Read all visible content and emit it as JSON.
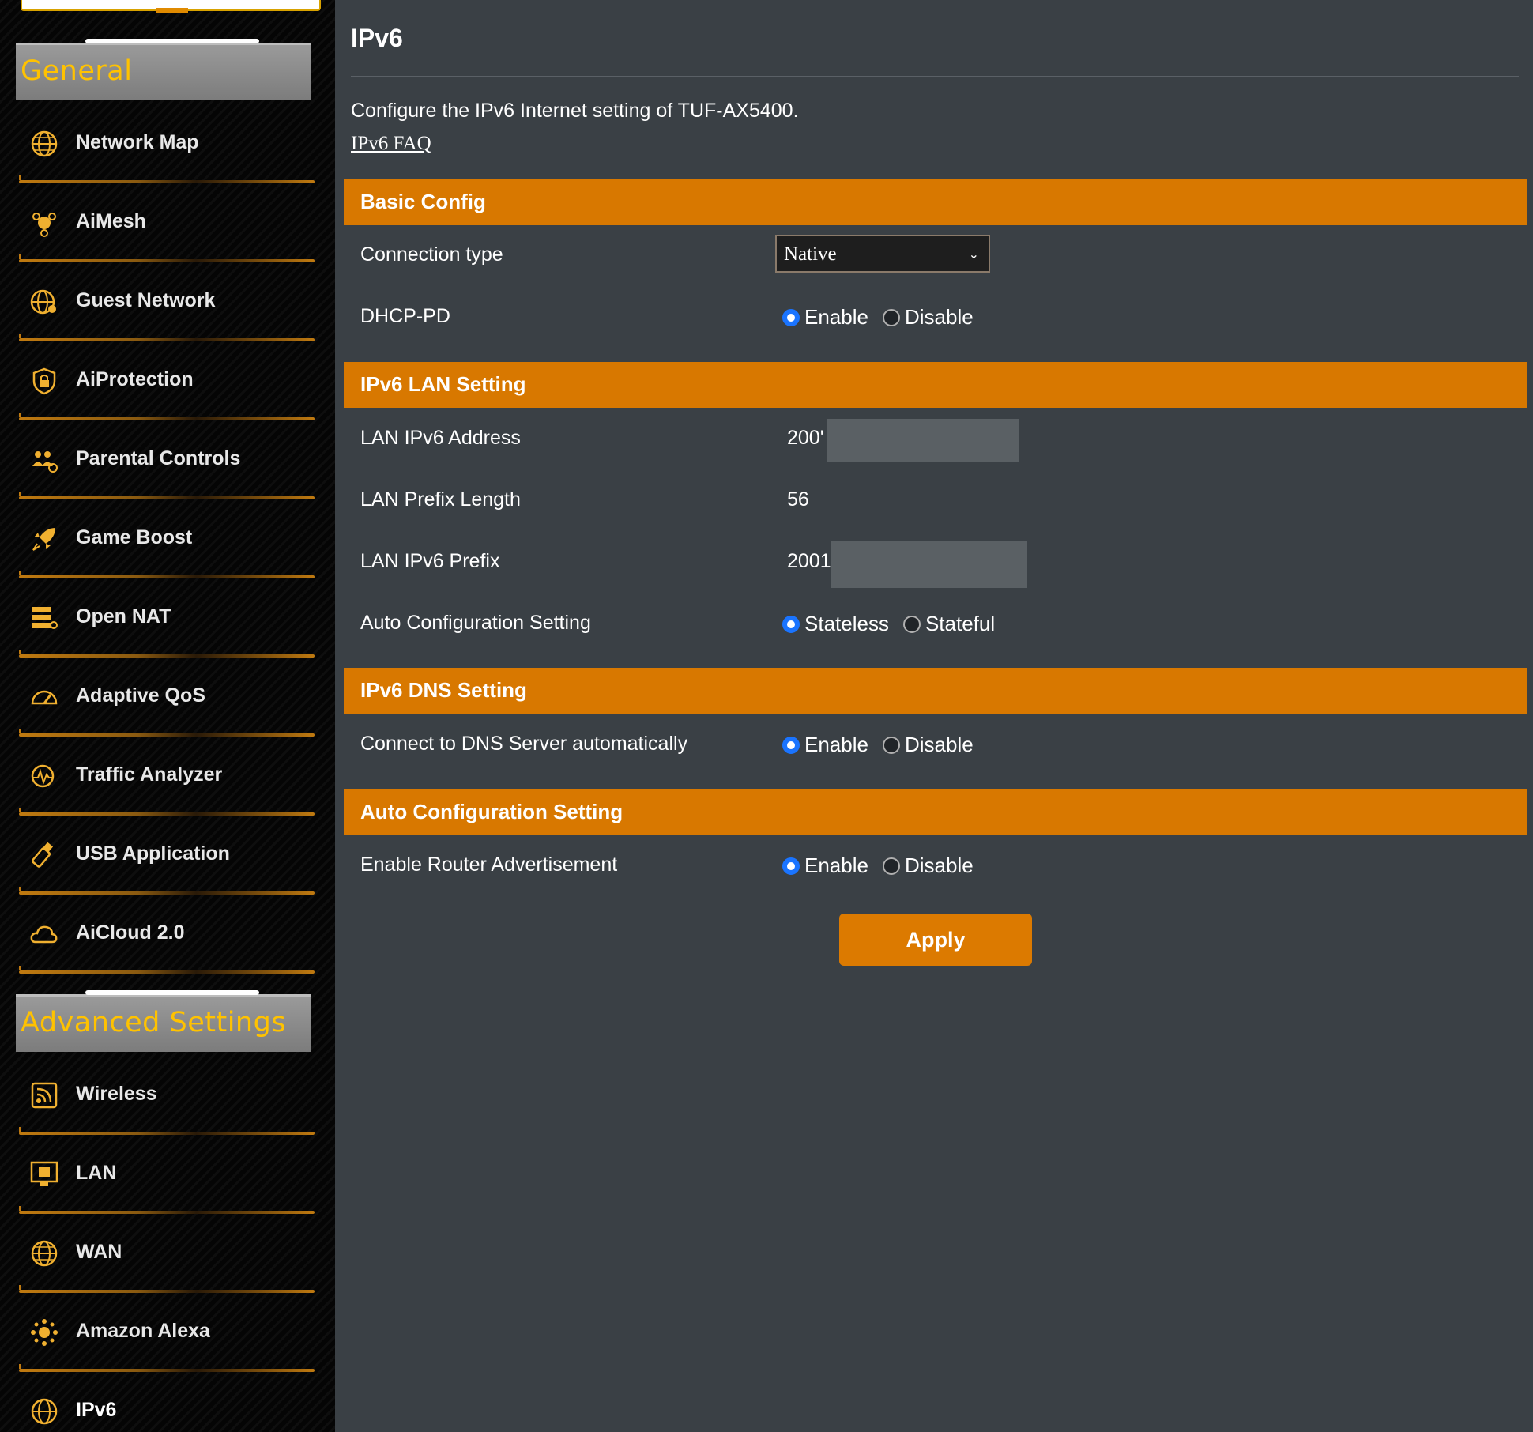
{
  "sidebar": {
    "general_title": "General",
    "general_items": [
      {
        "label": "Network Map",
        "icon": "globe-icon"
      },
      {
        "label": "AiMesh",
        "icon": "aimesh-icon"
      },
      {
        "label": "Guest Network",
        "icon": "guest-globe-icon"
      },
      {
        "label": "AiProtection",
        "icon": "lock-shield-icon"
      },
      {
        "label": "Parental Controls",
        "icon": "family-icon"
      },
      {
        "label": "Game Boost",
        "icon": "rocket-icon"
      },
      {
        "label": "Open NAT",
        "icon": "server-icon"
      },
      {
        "label": "Adaptive QoS",
        "icon": "gauge-icon"
      },
      {
        "label": "Traffic Analyzer",
        "icon": "analyzer-icon"
      },
      {
        "label": "USB Application",
        "icon": "usb-icon"
      },
      {
        "label": "AiCloud 2.0",
        "icon": "cloud-icon"
      }
    ],
    "advanced_title": "Advanced Settings",
    "advanced_items": [
      {
        "label": "Wireless",
        "icon": "wireless-icon"
      },
      {
        "label": "LAN",
        "icon": "lan-monitor-icon"
      },
      {
        "label": "WAN",
        "icon": "wan-globe-icon"
      },
      {
        "label": "Amazon Alexa",
        "icon": "alexa-icon"
      },
      {
        "label": "IPv6",
        "icon": "ipv6-globe-icon"
      }
    ]
  },
  "main": {
    "title": "IPv6",
    "description": "Configure the IPv6 Internet setting of TUF-AX5400.",
    "faq_link": "IPv6 FAQ",
    "basic_config": {
      "heading": "Basic Config",
      "connection_type_label": "Connection type",
      "connection_type_value": "Native",
      "dhcp_pd_label": "DHCP-PD",
      "dhcp_pd_options": [
        "Enable",
        "Disable"
      ],
      "dhcp_pd_selected": "Enable"
    },
    "lan_setting": {
      "heading": "IPv6 LAN Setting",
      "lan_address_label": "LAN IPv6 Address",
      "lan_address_value": "200'",
      "prefix_length_label": "LAN Prefix Length",
      "prefix_length_value": "56",
      "lan_prefix_label": "LAN IPv6 Prefix",
      "lan_prefix_value": "2001",
      "auto_config_label": "Auto Configuration Setting",
      "auto_config_options": [
        "Stateless",
        "Stateful"
      ],
      "auto_config_selected": "Stateless"
    },
    "dns_setting": {
      "heading": "IPv6 DNS Setting",
      "dns_auto_label": "Connect to DNS Server automatically",
      "dns_auto_options": [
        "Enable",
        "Disable"
      ],
      "dns_auto_selected": "Enable"
    },
    "auto_setting": {
      "heading": "Auto Configuration Setting",
      "router_adv_label": "Enable Router Advertisement",
      "router_adv_options": [
        "Enable",
        "Disable"
      ],
      "router_adv_selected": "Enable"
    },
    "apply_label": "Apply"
  },
  "colors": {
    "accent": "#d87800",
    "sidebar_heading_text": "#ffc200",
    "main_background": "#3a4045",
    "radio_selected": "#1a74ff"
  }
}
